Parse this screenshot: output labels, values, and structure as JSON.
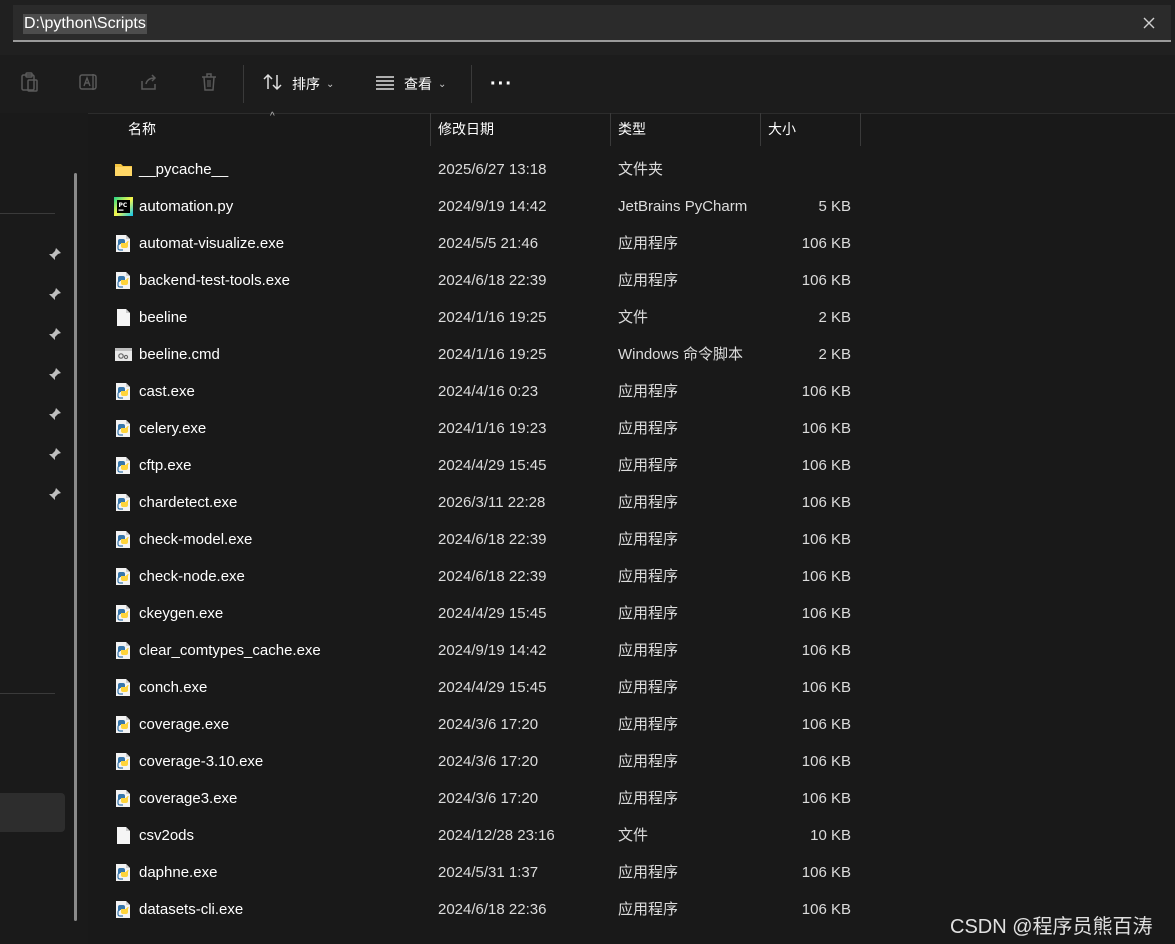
{
  "address": {
    "path": "D:\\python\\Scripts"
  },
  "toolbar": {
    "sort_label": "排序",
    "view_label": "查看",
    "more_label": "···"
  },
  "columns": {
    "name": "名称",
    "date": "修改日期",
    "type": "类型",
    "size": "大小"
  },
  "files": [
    {
      "name": "__pycache__",
      "date": "2025/6/27 13:18",
      "type": "文件夹",
      "size": "",
      "icon": "folder"
    },
    {
      "name": "automation.py",
      "date": "2024/9/19 14:42",
      "type": "JetBrains PyCharm",
      "size": "5 KB",
      "icon": "pycharm"
    },
    {
      "name": "automat-visualize.exe",
      "date": "2024/5/5 21:46",
      "type": "应用程序",
      "size": "106 KB",
      "icon": "python-exe"
    },
    {
      "name": "backend-test-tools.exe",
      "date": "2024/6/18 22:39",
      "type": "应用程序",
      "size": "106 KB",
      "icon": "python-exe"
    },
    {
      "name": "beeline",
      "date": "2024/1/16 19:25",
      "type": "文件",
      "size": "2 KB",
      "icon": "file"
    },
    {
      "name": "beeline.cmd",
      "date": "2024/1/16 19:25",
      "type": "Windows 命令脚本",
      "size": "2 KB",
      "icon": "cmd"
    },
    {
      "name": "cast.exe",
      "date": "2024/4/16 0:23",
      "type": "应用程序",
      "size": "106 KB",
      "icon": "python-exe"
    },
    {
      "name": "celery.exe",
      "date": "2024/1/16 19:23",
      "type": "应用程序",
      "size": "106 KB",
      "icon": "python-exe"
    },
    {
      "name": "cftp.exe",
      "date": "2024/4/29 15:45",
      "type": "应用程序",
      "size": "106 KB",
      "icon": "python-exe"
    },
    {
      "name": "chardetect.exe",
      "date": "2026/3/11 22:28",
      "type": "应用程序",
      "size": "106 KB",
      "icon": "python-exe"
    },
    {
      "name": "check-model.exe",
      "date": "2024/6/18 22:39",
      "type": "应用程序",
      "size": "106 KB",
      "icon": "python-exe"
    },
    {
      "name": "check-node.exe",
      "date": "2024/6/18 22:39",
      "type": "应用程序",
      "size": "106 KB",
      "icon": "python-exe"
    },
    {
      "name": "ckeygen.exe",
      "date": "2024/4/29 15:45",
      "type": "应用程序",
      "size": "106 KB",
      "icon": "python-exe"
    },
    {
      "name": "clear_comtypes_cache.exe",
      "date": "2024/9/19 14:42",
      "type": "应用程序",
      "size": "106 KB",
      "icon": "python-exe"
    },
    {
      "name": "conch.exe",
      "date": "2024/4/29 15:45",
      "type": "应用程序",
      "size": "106 KB",
      "icon": "python-exe"
    },
    {
      "name": "coverage.exe",
      "date": "2024/3/6 17:20",
      "type": "应用程序",
      "size": "106 KB",
      "icon": "python-exe"
    },
    {
      "name": "coverage-3.10.exe",
      "date": "2024/3/6 17:20",
      "type": "应用程序",
      "size": "106 KB",
      "icon": "python-exe"
    },
    {
      "name": "coverage3.exe",
      "date": "2024/3/6 17:20",
      "type": "应用程序",
      "size": "106 KB",
      "icon": "python-exe"
    },
    {
      "name": "csv2ods",
      "date": "2024/12/28 23:16",
      "type": "文件",
      "size": "10 KB",
      "icon": "file"
    },
    {
      "name": "daphne.exe",
      "date": "2024/5/31 1:37",
      "type": "应用程序",
      "size": "106 KB",
      "icon": "python-exe"
    },
    {
      "name": "datasets-cli.exe",
      "date": "2024/6/18 22:36",
      "type": "应用程序",
      "size": "106 KB",
      "icon": "python-exe"
    }
  ],
  "watermark": "CSDN @程序员熊百涛",
  "colors": {
    "folder": "#f4c542",
    "python_blue": "#3776ab",
    "python_yellow": "#ffd43b",
    "accent": "#4d4d4d"
  }
}
